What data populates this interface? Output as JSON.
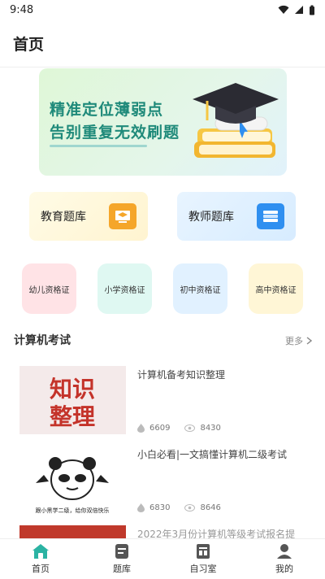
{
  "status_bar": {
    "time": "9:48"
  },
  "header": {
    "title": "首页"
  },
  "banner": {
    "line1": "精准定位薄弱点",
    "line2": "告别重复无效刷题"
  },
  "banks": [
    {
      "label": "教育题库",
      "icon": "graduation-cap-icon"
    },
    {
      "label": "教师题库",
      "icon": "book-stack-icon"
    }
  ],
  "certs": [
    "幼儿资格证",
    "小学资格证",
    "初中资格证",
    "高中资格证"
  ],
  "section": {
    "title": "计算机考试",
    "more": "更多"
  },
  "articles": [
    {
      "title": "计算机备考知识整理",
      "likes": "6609",
      "views": "8430",
      "thumb_text_1": "知识",
      "thumb_text_2": "整理"
    },
    {
      "title": "小白必看|一文搞懂计算机二级考试",
      "likes": "6830",
      "views": "8646",
      "thumb_caption": "跟小黑学二级，给你双倍快乐"
    },
    {
      "title": "2022年3月份计算机等级考试报名提"
    }
  ],
  "tabs": [
    {
      "label": "首页",
      "icon": "home-icon",
      "active": true
    },
    {
      "label": "题库",
      "icon": "question-bank-icon"
    },
    {
      "label": "自习室",
      "icon": "study-room-icon"
    },
    {
      "label": "我的",
      "icon": "profile-icon"
    }
  ],
  "colors": {
    "accent": "#2bb3a3",
    "banner_text": "#1f8a7a"
  }
}
